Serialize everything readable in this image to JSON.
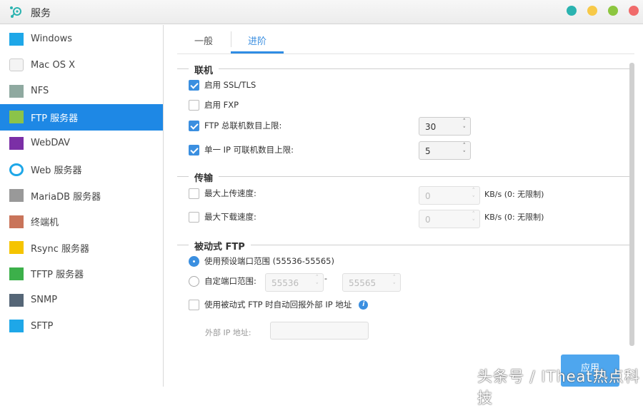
{
  "window": {
    "title": "服务",
    "controls": [
      {
        "name": "teal",
        "color": "#2bb3b0"
      },
      {
        "name": "minimize",
        "color": "#f7c948"
      },
      {
        "name": "maximize",
        "color": "#8cc63f"
      },
      {
        "name": "close",
        "color": "#f06b6b"
      }
    ]
  },
  "sidebar": {
    "items": [
      {
        "label": "Windows",
        "icon": "windows-icon",
        "color": "#1ea7e8"
      },
      {
        "label": "Mac OS X",
        "icon": "mac-icon",
        "color": "#aaaaaa"
      },
      {
        "label": "NFS",
        "icon": "nfs-icon",
        "color": "#8fa9a0"
      },
      {
        "label": "FTP 服务器",
        "icon": "ftp-icon",
        "color": "#8bc34a",
        "selected": true
      },
      {
        "label": "WebDAV",
        "icon": "webdav-icon",
        "color": "#7b2fa6"
      },
      {
        "label": "Web 服务器",
        "icon": "web-server-icon",
        "color": "#1ea7e8"
      },
      {
        "label": "MariaDB 服务器",
        "icon": "mariadb-icon",
        "color": "#999999"
      },
      {
        "label": "终端机",
        "icon": "terminal-icon",
        "color": "#c9745a"
      },
      {
        "label": "Rsync 服务器",
        "icon": "rsync-icon",
        "color": "#f5c400"
      },
      {
        "label": "TFTP 服务器",
        "icon": "tftp-icon",
        "color": "#3cb04a"
      },
      {
        "label": "SNMP",
        "icon": "snmp-icon",
        "color": "#556677"
      },
      {
        "label": "SFTP",
        "icon": "sftp-icon",
        "color": "#1ea7e8"
      }
    ]
  },
  "tabs": [
    {
      "label": "一般"
    },
    {
      "label": "进阶",
      "active": true
    }
  ],
  "connection": {
    "title": "联机",
    "ssl": {
      "label": "启用 SSL/TLS",
      "checked": true
    },
    "fxp": {
      "label": "启用 FXP",
      "checked": false
    },
    "max_total": {
      "label": "FTP 总联机数目上限:",
      "checked": true,
      "value": "30"
    },
    "max_per_ip": {
      "label": "单一 IP 可联机数目上限:",
      "checked": true,
      "value": "5"
    }
  },
  "transfer": {
    "title": "传输",
    "upload": {
      "label": "最大上传速度:",
      "checked": false,
      "value": "0",
      "unit": "KB/s (0: 无限制)"
    },
    "download": {
      "label": "最大下载速度:",
      "checked": false,
      "value": "0",
      "unit": "KB/s (0: 无限制)"
    }
  },
  "passive": {
    "title": "被动式 FTP",
    "default_range": {
      "label": "使用预设端口范围 (55536-55565)",
      "selected": true
    },
    "custom_range": {
      "label": "自定端口范围:",
      "from": "55536",
      "sep": "-",
      "to": "55565"
    },
    "report_ip": {
      "label": "使用被动式 FTP 时自动回报外部 IP 地址",
      "checked": false
    },
    "external_ip": {
      "label": "外部 IP 地址:",
      "value": ""
    }
  },
  "apply_label": "应用",
  "watermark": "头条号 / ITheat热点科技"
}
